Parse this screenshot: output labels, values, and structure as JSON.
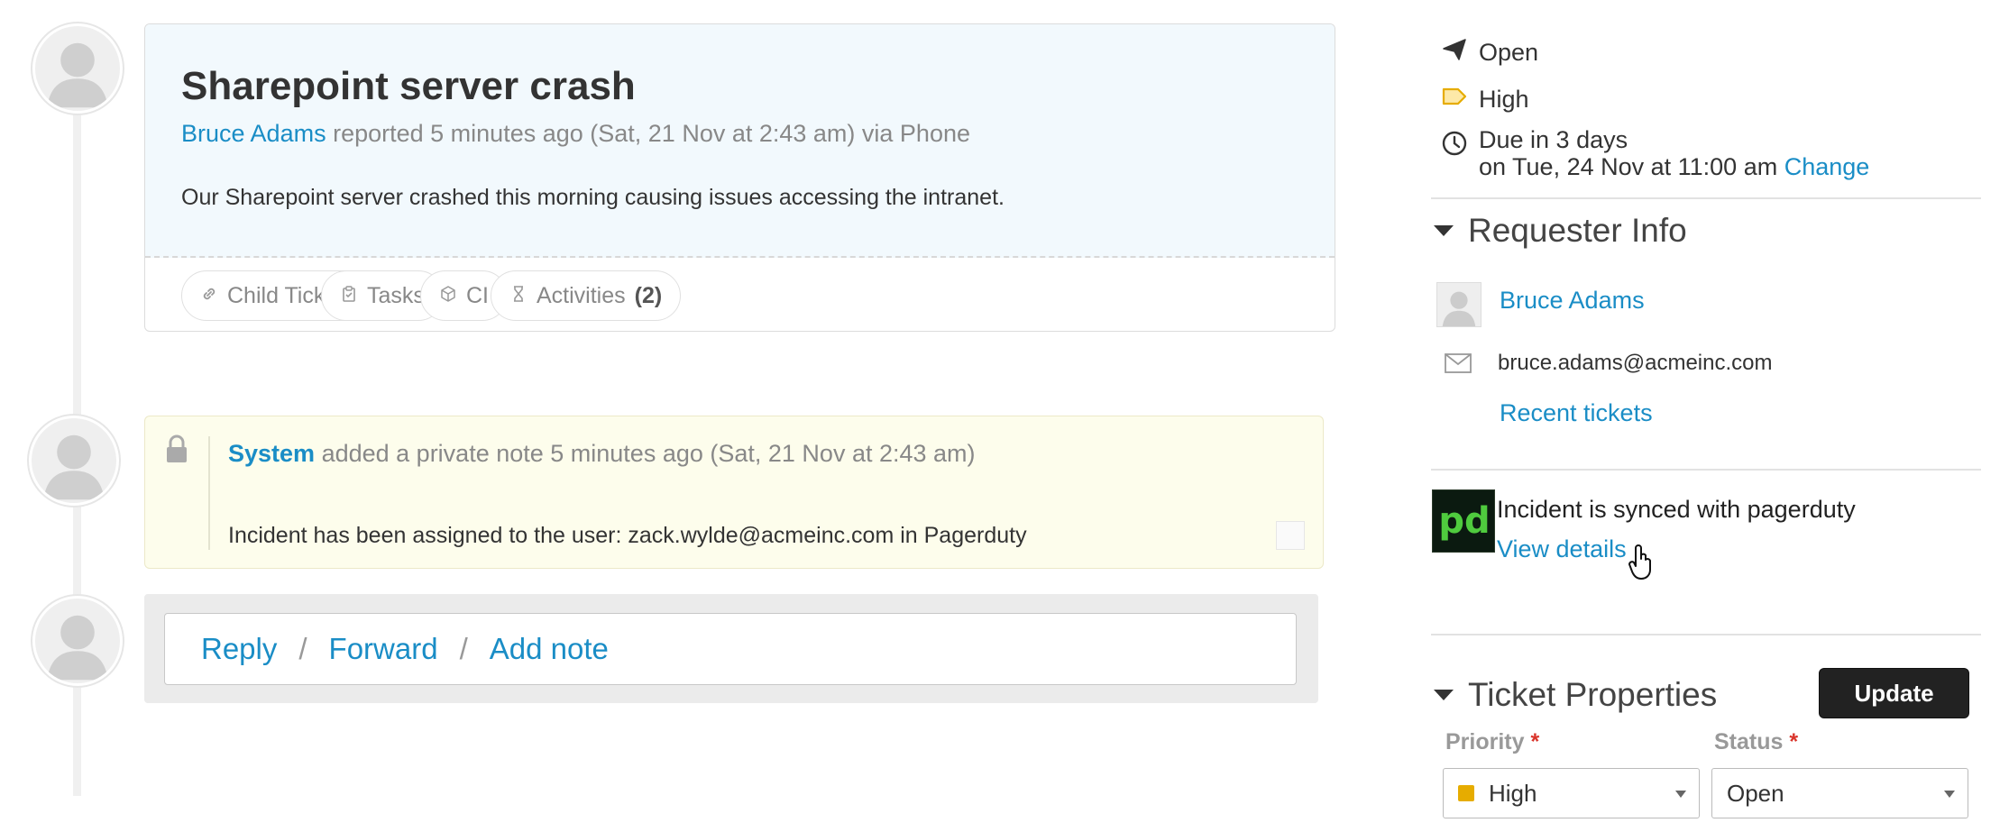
{
  "ticket": {
    "title": "Sharepoint server crash",
    "requester": "Bruce Adams",
    "reported_text": "reported 5 minutes ago (Sat, 21 Nov at 2:43 am) via Phone",
    "description": "Our Sharepoint server crashed this morning causing issues accessing the intranet.",
    "tabs": [
      {
        "label": "Child Tickets",
        "icon": "link-icon"
      },
      {
        "label": "Tasks",
        "icon": "clipboard-check-icon"
      },
      {
        "label": "CI",
        "icon": "cube-icon"
      },
      {
        "label": "Activities",
        "count": "(2)",
        "icon": "hourglass-icon"
      }
    ]
  },
  "note": {
    "author": "System",
    "meta_text": "added a private note 5 minutes ago (Sat, 21 Nov at 2:43 am)",
    "body": "Incident has been assigned to the user: zack.wylde@acmeinc.com in Pagerduty"
  },
  "reply": {
    "reply_label": "Reply",
    "forward_label": "Forward",
    "add_note_label": "Add note",
    "separator": "/"
  },
  "sidebar": {
    "status": "Open",
    "priority": "High",
    "due_line1": "Due in 3 days",
    "due_line2": "on Tue, 24 Nov at 11:00 am",
    "change_label": "Change",
    "requester_section_title": "Requester Info",
    "requester_name": "Bruce Adams",
    "requester_email": "bruce.adams@acmeinc.com",
    "recent_tickets_label": "Recent tickets",
    "pagerduty_text": "Incident is synced with pagerduty",
    "view_details_label": "View details",
    "pagerduty_logo_text": "pd",
    "properties_title": "Ticket Properties",
    "update_label": "Update",
    "priority_field_label": "Priority",
    "status_field_label": "Status",
    "required_mark": "*",
    "priority_value": "High",
    "status_value": "Open"
  },
  "colors": {
    "link": "#1a8dc6",
    "priority_high": "#e6ac00",
    "required": "#d9342b",
    "ticket_bg": "#f2f9fd",
    "note_bg": "#fdfdec",
    "pagerduty_green": "#4fcb3e"
  }
}
